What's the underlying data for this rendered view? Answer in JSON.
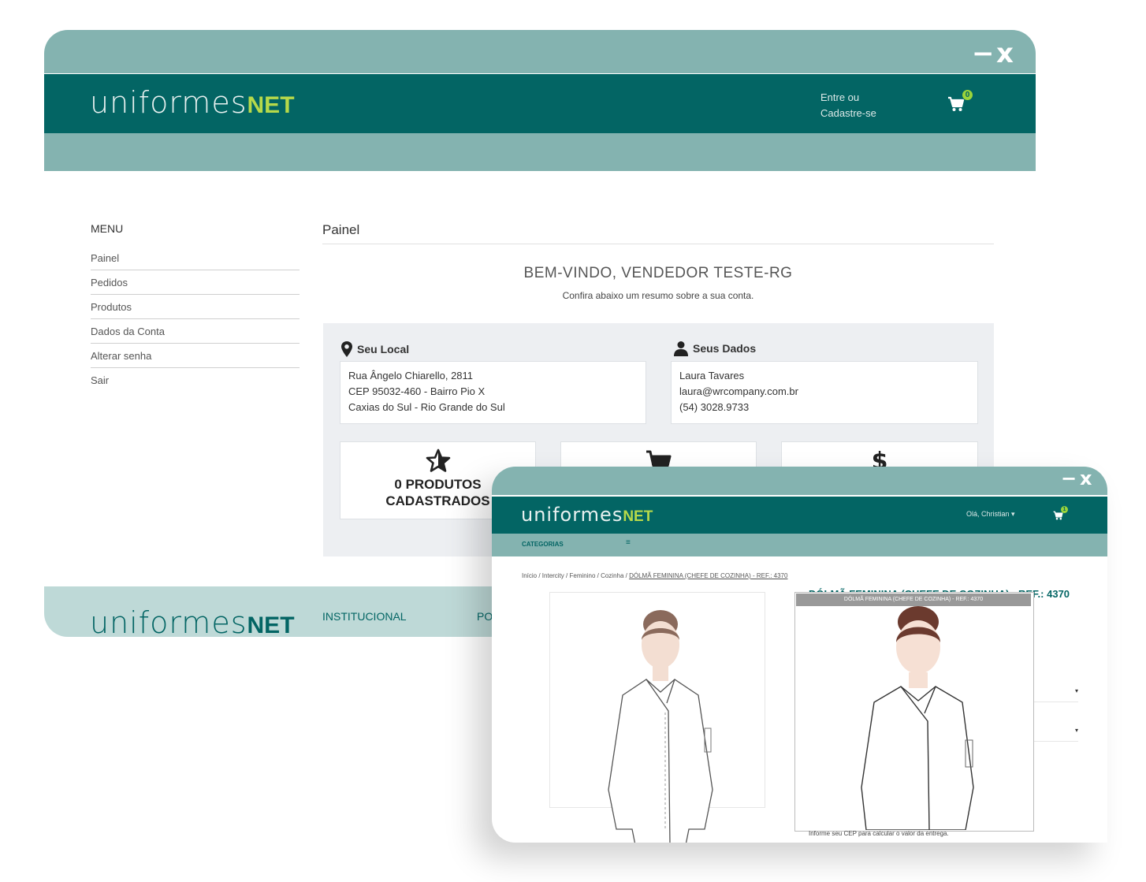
{
  "window_back": {
    "controls": {
      "minimize": "−",
      "close": "x"
    },
    "logo": {
      "part1": "uniformes",
      "part2": "NET"
    },
    "header": {
      "login_line1": "Entre ou",
      "login_line2": "Cadastre-se",
      "cart_count": "0"
    },
    "menu": {
      "title": "MENU",
      "items": [
        "Painel",
        "Pedidos",
        "Produtos",
        "Dados da Conta",
        "Alterar senha",
        "Sair"
      ]
    },
    "panel": {
      "title": "Painel",
      "welcome": "BEM-VINDO, VENDEDOR TESTE-RG",
      "subtitle": "Confira abaixo um resumo sobre a sua conta."
    },
    "location": {
      "label": "Seu Local",
      "line1": "Rua Ângelo Chiarello, 2811",
      "line2": "CEP 95032-460 - Bairro Pio X",
      "line3": "Caxias do Sul - Rio Grande do Sul"
    },
    "personal": {
      "label": "Seus Dados",
      "name": "Laura Tavares",
      "email": "laura@wrcompany.com.br",
      "phone": "(54) 3028.9733"
    },
    "stats": {
      "products_line1": "0 PRODUTOS",
      "products_line2": "CADASTRADOS"
    },
    "footer": {
      "logo_part1": "uniformes",
      "logo_part2": "NET",
      "link1": "INSTITUCIONAL",
      "link2": "PO"
    }
  },
  "window_front": {
    "controls": {
      "minimize": "−",
      "close": "x"
    },
    "logo": {
      "part1": "uniformes",
      "part2": "NET"
    },
    "header": {
      "greeting": "Olá, Christian ▾",
      "cart_count": "1"
    },
    "categories_label": "CATEGORIAS",
    "menu_glyph": "≡",
    "breadcrumb": {
      "items": [
        "Início",
        "Intercity",
        "Feminino",
        "Cozinha"
      ],
      "current": "DÓLMÃ FEMININA (CHEFE DE COZINHA) - REF.: 4370",
      "separator": " / "
    },
    "product_title": "DÓLMÃ FEMININA (CHEFE DE COZINHA) - REF.: 4370",
    "zoom_title": "DÓLMÃ FEMININA (CHEFE DE COZINHA) - REF.: 4370",
    "select_arrow": "▾",
    "cep_note": "Informe seu CEP para calcular o valor da entrega."
  },
  "colors": {
    "primary": "#036564",
    "light": "#84b3b0",
    "footer": "#bed9d7",
    "accent": "#b7d94a",
    "panel_bg": "#edeff2"
  },
  "icons": [
    "map-pin-icon",
    "user-icon",
    "star-icon",
    "cart-icon",
    "dollar-icon",
    "hamburger-icon"
  ]
}
